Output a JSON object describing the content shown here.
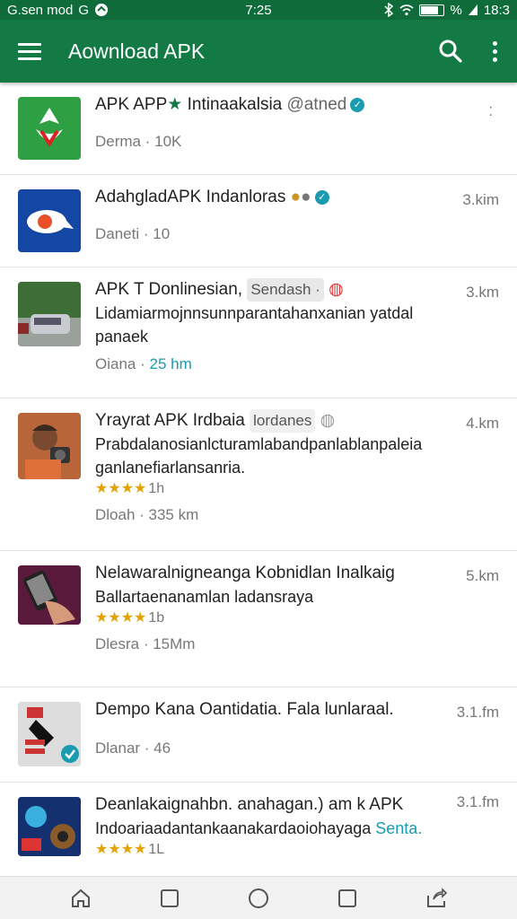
{
  "status_bar": {
    "left_text": "G.sen mod",
    "carrier_glyph": "G",
    "time": "7:25",
    "battery_text": "%",
    "right_text": "18:3"
  },
  "app_bar": {
    "title": "Aownload APK",
    "icons": [
      "menu-icon",
      "search-icon",
      "more-vert-icon"
    ]
  },
  "items": [
    {
      "title": "APK APP",
      "title_after_star": "Intinaakalsia",
      "title_suffix": "@atned",
      "meta": "Derma · 10K",
      "thumb_color": "#2ea043"
    },
    {
      "title": "AdahgladAPK Indanloras",
      "distance": "3.kim",
      "meta": "Daneti · 10",
      "thumb_color": "#1347a3"
    },
    {
      "title": "APK T Donlinesian,",
      "tag": "Sendash ·",
      "distance": "3.km",
      "description": "Lidamiarmojnnsunnparantahanxanian yatdal panaek",
      "meta_prefix": "Oiana ·",
      "meta_highlight": "25 hm"
    },
    {
      "title": "Yrayrat APK Irdbaia",
      "title_suffix": "lordanes",
      "distance": "4.km",
      "description": "Prabdalanosianlcturamlabandpanlablanpaleia ganlanefiarlansanria.",
      "stars": "★★★★",
      "star_count": "1h",
      "meta": "Dloah · 335 km"
    },
    {
      "title": "Nelawaralnigneanga Kobnidlan Inalkaig",
      "distance": "5.km",
      "description": "Ballartaenanamlan ladansraya",
      "stars": "★★★★",
      "star_count": "1b",
      "meta": "Dlesra · 15Mm"
    },
    {
      "title": "Dempo Kana Oantidatia. Fala lunlaraal.",
      "distance": "3.1.fm",
      "meta": "Dlanar · 46"
    },
    {
      "title": "Deanlakaignahbn. anahagan.) am k APK",
      "distance": "3.1.fm",
      "description": "Indoariaadantankaanakardaoiohayaga",
      "desc_link": "Senta.",
      "stars": "★★★★",
      "star_count": "1L"
    }
  ],
  "colors": {
    "app_bar": "#137a45",
    "status_bar": "#0f6b3a",
    "accent": "#1a9bb0",
    "star": "#e2a300"
  },
  "nav_bar": {
    "icons": [
      "home-icon",
      "square-icon",
      "circle-icon",
      "recents-icon",
      "share-icon"
    ]
  }
}
